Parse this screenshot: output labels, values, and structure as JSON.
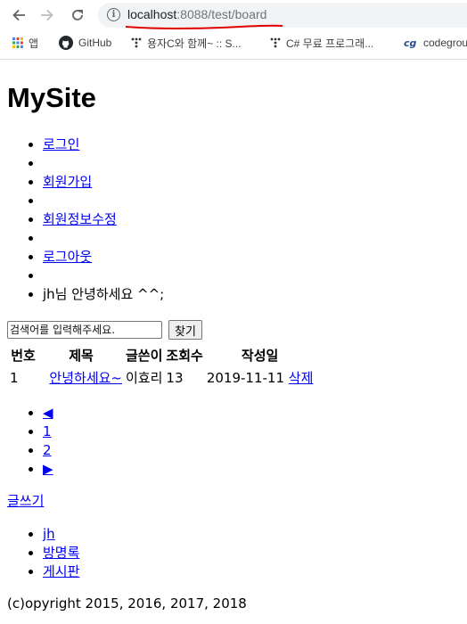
{
  "browser": {
    "url_host": "localhost",
    "url_rest": ":8088/test/board",
    "bookmarks": [
      {
        "label": "앱",
        "icon": "apps-grid-icon"
      },
      {
        "label": "GitHub",
        "icon": "github-icon"
      },
      {
        "label": "용자C와 함께~ :: S...",
        "icon": "tistory-icon"
      },
      {
        "label": "C# 무료 프로그래...",
        "icon": "tistory-icon"
      },
      {
        "label": "codegrou",
        "icon": "codeground-icon"
      }
    ],
    "annotation_color": "#e00000"
  },
  "site": {
    "title": "MySite"
  },
  "menu": {
    "login": "로그인",
    "join": "회원가입",
    "modify": "회원정보수정",
    "logout": "로그아웃",
    "greeting": "jh님 안녕하세요 ^^;"
  },
  "search": {
    "placeholder": "검색어를 입력해주세요.",
    "button": "찾기"
  },
  "board": {
    "headers": [
      "번호",
      "제목",
      "글쓴이",
      "조회수",
      "작성일"
    ],
    "rows": [
      {
        "no": "1",
        "title": "안녕하세요~",
        "author": "이효리",
        "views": "13",
        "date": "2019-11-11",
        "delete": "삭제"
      }
    ]
  },
  "pager": {
    "prev": "◀",
    "pages": [
      "1",
      "2"
    ],
    "next": "▶"
  },
  "write": "글쓰기",
  "footer_nav": [
    "jh",
    "방명록",
    "게시판"
  ],
  "copyright": "(c)opyright 2015, 2016, 2017, 2018"
}
